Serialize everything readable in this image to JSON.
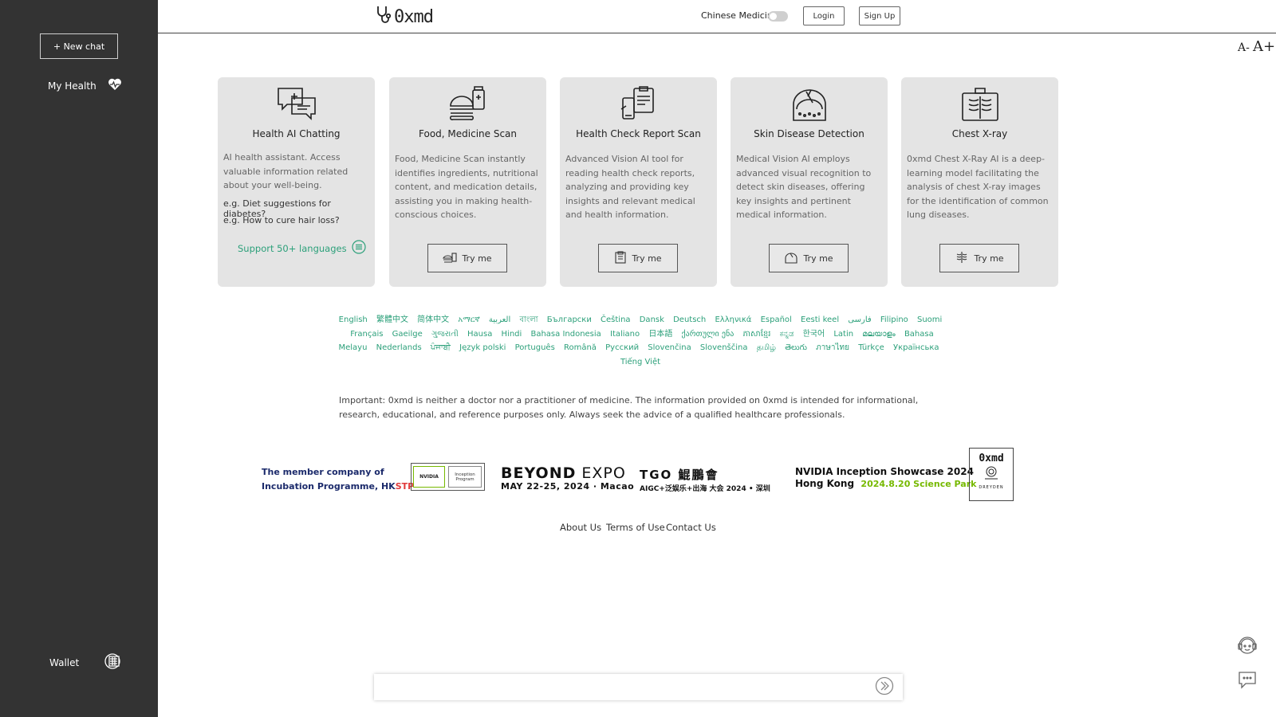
{
  "sidebar": {
    "new_chat": "+ New chat",
    "my_health": "My Health",
    "wallet": "Wallet"
  },
  "header": {
    "logo": "0xmd",
    "chinese_medicine_label": "Chinese Medicine",
    "chinese_medicine_toggle": false,
    "login": "Login",
    "signup": "Sign Up",
    "font_decrease": "A-",
    "font_increase": "A+"
  },
  "cards": [
    {
      "title": "Health AI Chatting",
      "description": "AI health assistant. Access valuable information related about your well-being.",
      "examples": [
        "e.g. Diet suggestions for diabetes?",
        "e.g. How to cure hair loss?"
      ],
      "support": "Support 50+ languages",
      "icon": "chat-bubble-icon"
    },
    {
      "title": "Food, Medicine Scan",
      "description": "Food, Medicine Scan instantly identifies ingredients, nutritional content, and medication details, assisting you in making health-conscious choices.",
      "button": "Try me",
      "icon": "burger-medicine-icon"
    },
    {
      "title": "Health Check Report Scan",
      "description": "Advanced Vision AI tool for reading health check reports, analyzing and providing key insights and relevant medical and health information.",
      "button": "Try me",
      "icon": "report-scan-icon"
    },
    {
      "title": "Skin Disease Detection",
      "description": "Medical Vision AI employs advanced visual recognition to detect skin diseases, offering key insights and pertinent medical information.",
      "button": "Try me",
      "icon": "skin-layer-icon"
    },
    {
      "title": "Chest X-ray",
      "description": "0xmd Chest X-Ray AI is a deep-learning model facilitating the analysis of chest X-ray images for the identification of common lung diseases.",
      "button": "Try me",
      "icon": "chest-xray-icon"
    }
  ],
  "languages": [
    "English",
    "繁體中文",
    "简体中文",
    "አማርኛ",
    "العربية",
    "বাংলা",
    "Български",
    "Čeština",
    "Dansk",
    "Deutsch",
    "Ελληνικά",
    "Español",
    "Eesti keel",
    "فارسی",
    "Filipino",
    "Suomi",
    "Français",
    "Gaeilge",
    "ગુજરાતી",
    "Hausa",
    "Hindi",
    "Bahasa Indonesia",
    "Italiano",
    "日本語",
    "ქართული ენა",
    "ភាសាខ្មែរ",
    "ಕನ್ನಡ",
    "한국어",
    "Latin",
    "മലയാളം",
    "Bahasa Melayu",
    "Nederlands",
    "ਪੰਜਾਬੀ",
    "Język polski",
    "Português",
    "Română",
    "Русский",
    "Slovenčina",
    "Slovenščina",
    "தமிழ்",
    "తెలుగు",
    "ภาษาไทย",
    "Türkçe",
    "Українська",
    "Tiếng Việt"
  ],
  "disclaimer": "Important: 0xmd is neither a doctor nor a practitioner of medicine. The information provided on 0xmd is intended for informational, research, educational, and reference purposes only. Always seek the advice of a qualified healthcare professionals.",
  "sponsors": {
    "hkstp_line1": "The member company of",
    "hkstp_line2": "Incubation Programme, HK",
    "hkstp_suffix": "STP",
    "nvidia_logo": "NVIDIA",
    "nvidia_program": "Inception Program",
    "beyond_bold": "BEYOND",
    "beyond_thin": " EXPO",
    "beyond_date": "MAY 22-25, 2024 · Macao",
    "tgo_line1": "TGO 鯤鵬會",
    "tgo_line2": "AIGC+泛娱乐+出海 大会  2024 • 深圳",
    "nv_showcase_line1": "NVIDIA Inception Showcase 2024",
    "nv_showcase_line2": "Hong Kong",
    "nv_showcase_date": "2024.8.20 Science Park",
    "oxmd_badge": "0xmd",
    "dreyden": "DREYDEN"
  },
  "footer": {
    "about": "About Us",
    "terms": "Terms of Use",
    "contact": "Contact Us"
  },
  "chat": {
    "placeholder": ""
  },
  "colors": {
    "sidebar_bg": "#333333",
    "card_bg": "#e4e4e4",
    "accent_green": "#2ca07a"
  }
}
